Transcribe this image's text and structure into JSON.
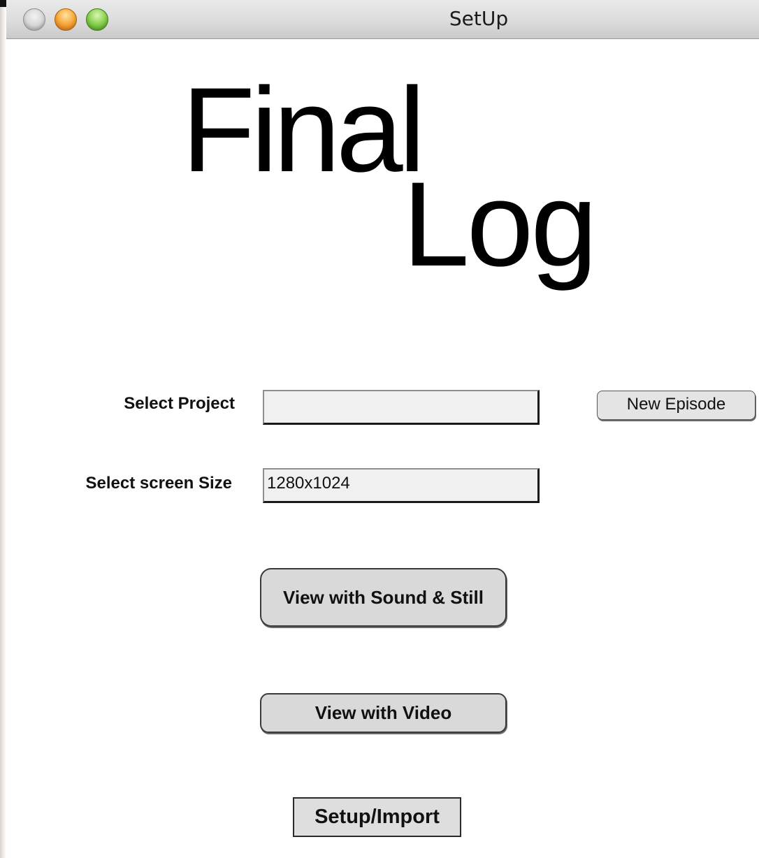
{
  "window": {
    "title": "SetUp"
  },
  "logo": {
    "line1": "Final",
    "line2": "Log"
  },
  "form": {
    "project_label": "Select Project",
    "project_value": "",
    "screen_size_label": "Select screen Size",
    "screen_size_value": "1280x1024"
  },
  "buttons": {
    "new_episode": "New Episode",
    "view_sound_still": "View with Sound & Still",
    "view_video": "View with Video",
    "setup_import": "Setup/Import"
  },
  "icons": {
    "close": "close-icon",
    "minimize": "minimize-icon",
    "zoom": "zoom-icon"
  },
  "colors": {
    "close": "#c8c8c8",
    "minimize": "#f6a73a",
    "zoom": "#87d04d",
    "button_fill": "#d9d9d9",
    "field_fill": "#f0f0f0"
  }
}
